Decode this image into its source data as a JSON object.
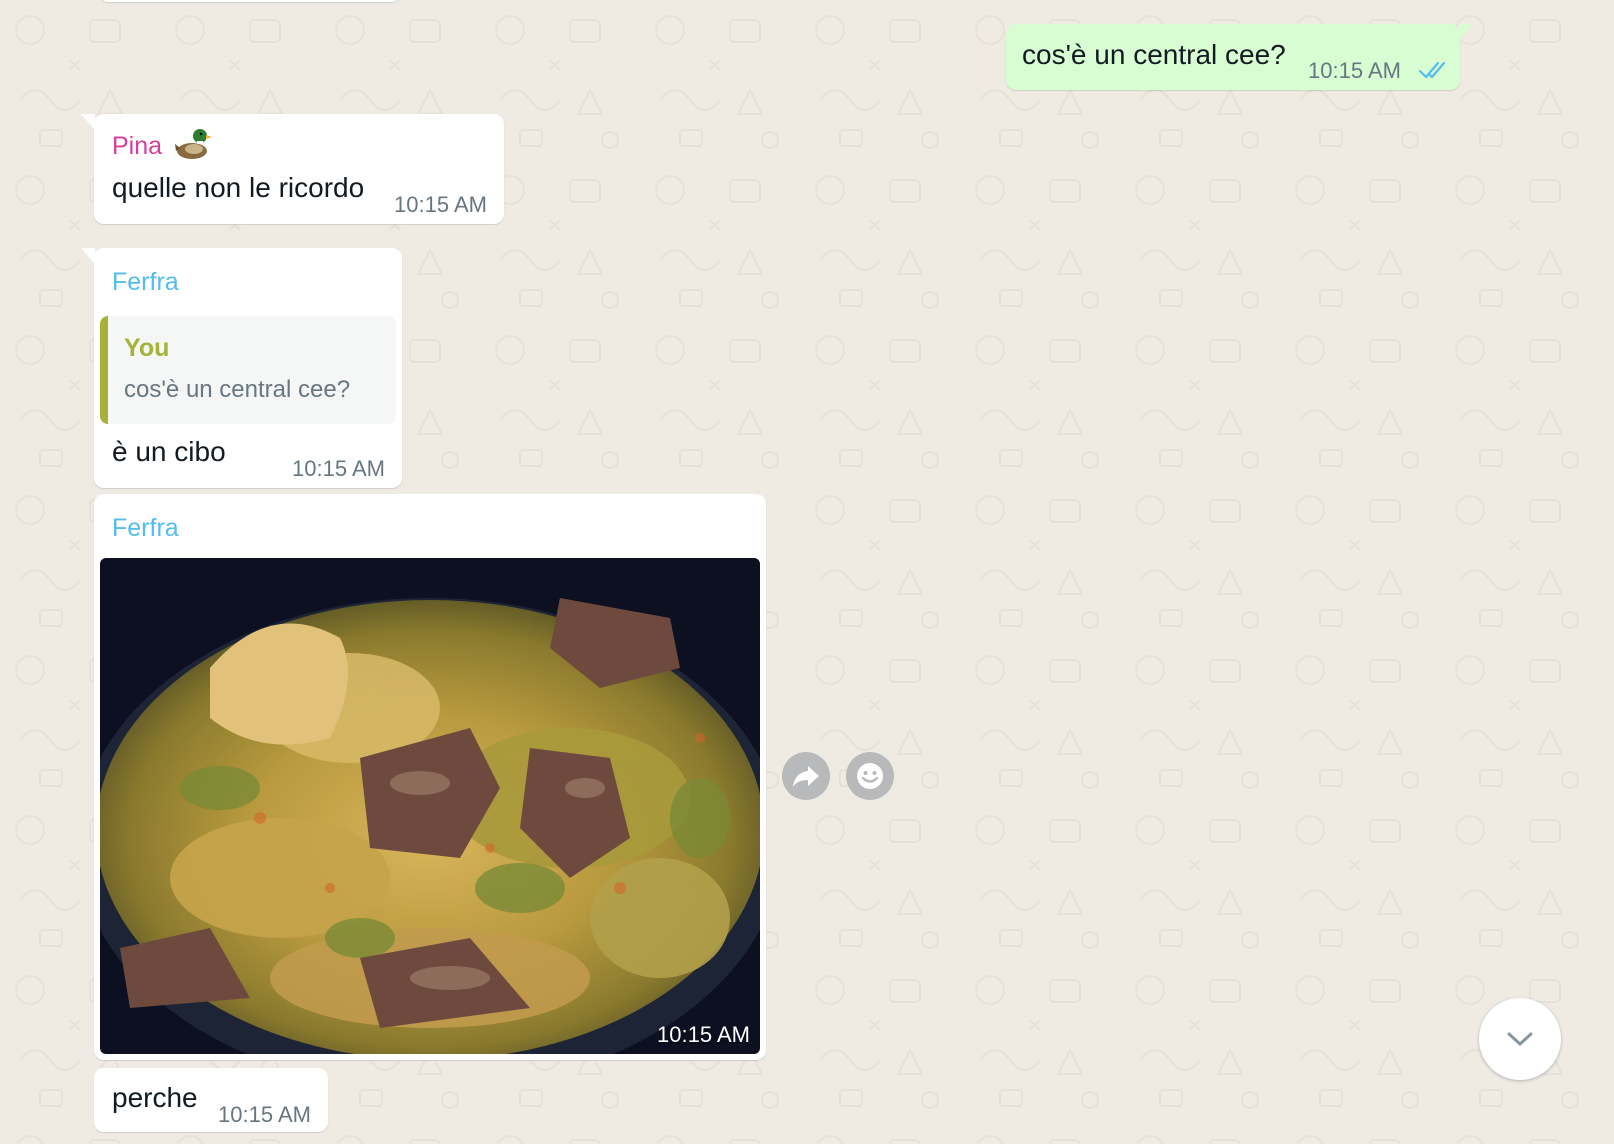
{
  "colors": {
    "wallpaper": "#efeae2",
    "incoming_bubble": "#ffffff",
    "outgoing_bubble": "#d9fdd3",
    "sender_pina": "#d63f9f",
    "sender_ferfra": "#53bdeb",
    "quote_accent": "#a5b337",
    "timestamp": "#667781",
    "read_ticks": "#53bdeb"
  },
  "messages": [
    {
      "direction": "outgoing",
      "text": "cos'è un central cee?",
      "time": "10:15 AM",
      "status_icon": "double-check-read-icon"
    },
    {
      "direction": "incoming",
      "sender": "Pina",
      "sender_emoji_icon": "duck-emoji-icon",
      "text": "quelle non le ricordo",
      "time": "10:15 AM"
    },
    {
      "direction": "incoming",
      "sender": "Ferfra",
      "quote": {
        "author": "You",
        "text": "cos'è un central cee?"
      },
      "text": "è un cibo",
      "time": "10:15 AM"
    },
    {
      "direction": "incoming",
      "sender": "Ferfra",
      "type": "image",
      "image_icon": "photo-cabbage-meat-stew",
      "time": "10:15 AM"
    },
    {
      "direction": "incoming",
      "text": "perche",
      "time": "10:15 AM"
    }
  ],
  "hover_actions": [
    {
      "icon": "forward-icon"
    },
    {
      "icon": "emoji-reaction-icon"
    }
  ],
  "scroll_button": {
    "icon": "chevron-down-icon"
  }
}
